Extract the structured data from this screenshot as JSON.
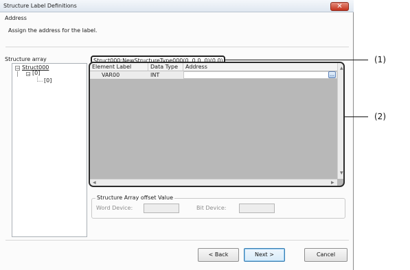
{
  "window": {
    "title": "Structure Label Definitions",
    "close_glyph": "✕"
  },
  "section": {
    "title": "Address",
    "description": "Assign the address for the label."
  },
  "structure_array": {
    "label": "Structure array",
    "value": "Struct000:NewStructureType000(0..0,0..0)(0,0)"
  },
  "tree": {
    "root": "Struct000",
    "child": "[0]",
    "grandchild": "[0]"
  },
  "table": {
    "headers": [
      "Element Label Name",
      "Data Type",
      "Address"
    ],
    "rows": [
      {
        "name": "VAR00",
        "type": "INT",
        "address": ""
      }
    ],
    "browse_glyph": "…"
  },
  "offset": {
    "legend": "Structure Array offset Value",
    "word_label": "Word Device:",
    "word_value": "",
    "bit_label": "Bit Device:",
    "bit_value": ""
  },
  "buttons": {
    "back": "< Back",
    "next": "Next >",
    "cancel": "Cancel"
  },
  "callouts": {
    "c1": "(1)",
    "c2": "(2)"
  },
  "colors": {
    "title_bar": "#dfe7f0",
    "close_button": "#c3321c",
    "grid_background": "#b8b8b8"
  },
  "icons": {
    "close": "close-icon",
    "tree_toggle": "minus-box-icon",
    "browse": "ellipsis-icon"
  }
}
